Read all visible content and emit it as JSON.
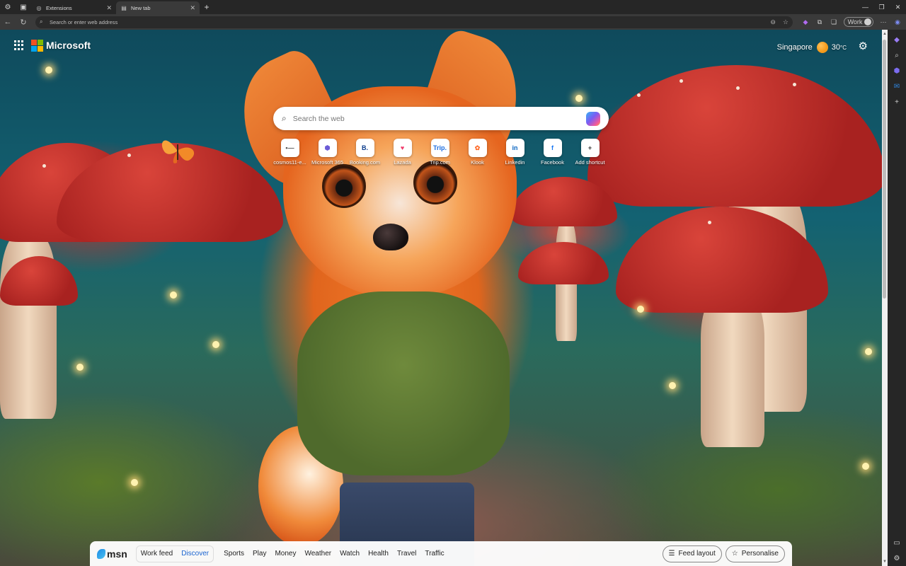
{
  "tabs": [
    {
      "label": "Extensions",
      "active": false
    },
    {
      "label": "New tab",
      "active": true
    }
  ],
  "address_bar": {
    "placeholder": "Search or enter web address"
  },
  "profile": {
    "label": "Work"
  },
  "header": {
    "brand": "Microsoft",
    "city": "Singapore",
    "temperature": "30",
    "unit": "°C"
  },
  "search": {
    "placeholder": "Search the web"
  },
  "shortcuts": [
    {
      "label": "cosmos11-e...",
      "icon": "cosmos-icon",
      "glyph": "•—",
      "color": "#555555"
    },
    {
      "label": "Microsoft 365",
      "icon": "microsoft365-icon",
      "glyph": "⬢",
      "color": "#6b5bd6"
    },
    {
      "label": "Booking.com",
      "icon": "booking-icon",
      "glyph": "B.",
      "color": "#0b3c8c"
    },
    {
      "label": "Lazada",
      "icon": "lazada-icon",
      "glyph": "♥",
      "color": "#f03a6b"
    },
    {
      "label": "Trip.com",
      "icon": "trip-icon",
      "glyph": "Trip.",
      "color": "#1e6fe0"
    },
    {
      "label": "Klook",
      "icon": "klook-icon",
      "glyph": "✿",
      "color": "#ff6a28"
    },
    {
      "label": "Linkedin",
      "icon": "linkedin-icon",
      "glyph": "in",
      "color": "#0a66c2"
    },
    {
      "label": "Facebook",
      "icon": "facebook-icon",
      "glyph": "f",
      "color": "#1877f2"
    },
    {
      "label": "Add shortcut",
      "icon": "plus-icon",
      "glyph": "+",
      "color": "#333333"
    }
  ],
  "msn": {
    "brand": "msn",
    "feed_toggle": [
      "Work feed",
      "Discover"
    ],
    "selected_feed": "Discover",
    "nav": [
      "Sports",
      "Play",
      "Money",
      "Weather",
      "Watch",
      "Health",
      "Travel",
      "Traffic"
    ],
    "feed_layout": "Feed layout",
    "personalise": "Personalise"
  },
  "colors": {
    "accent": "#1a64d0",
    "browser_chrome": "#262626"
  }
}
